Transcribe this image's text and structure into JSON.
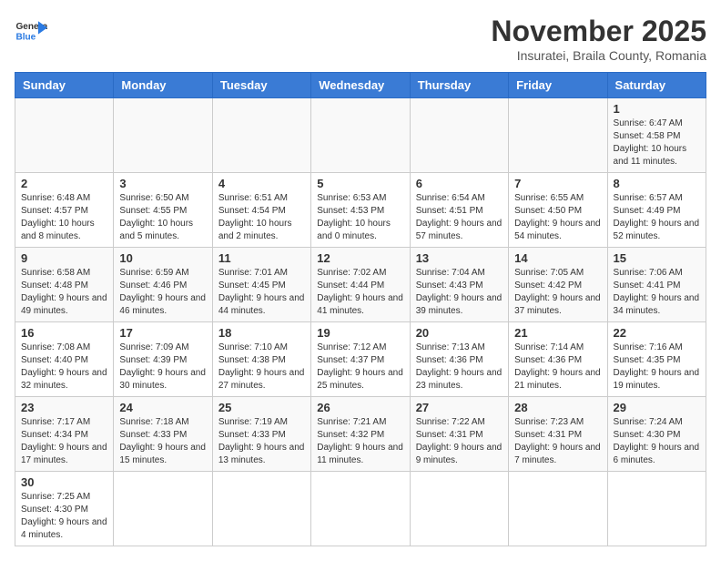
{
  "logo": {
    "text_general": "General",
    "text_blue": "Blue"
  },
  "title": "November 2025",
  "subtitle": "Insuratei, Braila County, Romania",
  "days_of_week": [
    "Sunday",
    "Monday",
    "Tuesday",
    "Wednesday",
    "Thursday",
    "Friday",
    "Saturday"
  ],
  "weeks": [
    [
      null,
      null,
      null,
      null,
      null,
      null,
      {
        "day": "1",
        "info": "Sunrise: 6:47 AM\nSunset: 4:58 PM\nDaylight: 10 hours and 11 minutes."
      }
    ],
    [
      {
        "day": "2",
        "info": "Sunrise: 6:48 AM\nSunset: 4:57 PM\nDaylight: 10 hours and 8 minutes."
      },
      {
        "day": "3",
        "info": "Sunrise: 6:50 AM\nSunset: 4:55 PM\nDaylight: 10 hours and 5 minutes."
      },
      {
        "day": "4",
        "info": "Sunrise: 6:51 AM\nSunset: 4:54 PM\nDaylight: 10 hours and 2 minutes."
      },
      {
        "day": "5",
        "info": "Sunrise: 6:53 AM\nSunset: 4:53 PM\nDaylight: 10 hours and 0 minutes."
      },
      {
        "day": "6",
        "info": "Sunrise: 6:54 AM\nSunset: 4:51 PM\nDaylight: 9 hours and 57 minutes."
      },
      {
        "day": "7",
        "info": "Sunrise: 6:55 AM\nSunset: 4:50 PM\nDaylight: 9 hours and 54 minutes."
      },
      {
        "day": "8",
        "info": "Sunrise: 6:57 AM\nSunset: 4:49 PM\nDaylight: 9 hours and 52 minutes."
      }
    ],
    [
      {
        "day": "9",
        "info": "Sunrise: 6:58 AM\nSunset: 4:48 PM\nDaylight: 9 hours and 49 minutes."
      },
      {
        "day": "10",
        "info": "Sunrise: 6:59 AM\nSunset: 4:46 PM\nDaylight: 9 hours and 46 minutes."
      },
      {
        "day": "11",
        "info": "Sunrise: 7:01 AM\nSunset: 4:45 PM\nDaylight: 9 hours and 44 minutes."
      },
      {
        "day": "12",
        "info": "Sunrise: 7:02 AM\nSunset: 4:44 PM\nDaylight: 9 hours and 41 minutes."
      },
      {
        "day": "13",
        "info": "Sunrise: 7:04 AM\nSunset: 4:43 PM\nDaylight: 9 hours and 39 minutes."
      },
      {
        "day": "14",
        "info": "Sunrise: 7:05 AM\nSunset: 4:42 PM\nDaylight: 9 hours and 37 minutes."
      },
      {
        "day": "15",
        "info": "Sunrise: 7:06 AM\nSunset: 4:41 PM\nDaylight: 9 hours and 34 minutes."
      }
    ],
    [
      {
        "day": "16",
        "info": "Sunrise: 7:08 AM\nSunset: 4:40 PM\nDaylight: 9 hours and 32 minutes."
      },
      {
        "day": "17",
        "info": "Sunrise: 7:09 AM\nSunset: 4:39 PM\nDaylight: 9 hours and 30 minutes."
      },
      {
        "day": "18",
        "info": "Sunrise: 7:10 AM\nSunset: 4:38 PM\nDaylight: 9 hours and 27 minutes."
      },
      {
        "day": "19",
        "info": "Sunrise: 7:12 AM\nSunset: 4:37 PM\nDaylight: 9 hours and 25 minutes."
      },
      {
        "day": "20",
        "info": "Sunrise: 7:13 AM\nSunset: 4:36 PM\nDaylight: 9 hours and 23 minutes."
      },
      {
        "day": "21",
        "info": "Sunrise: 7:14 AM\nSunset: 4:36 PM\nDaylight: 9 hours and 21 minutes."
      },
      {
        "day": "22",
        "info": "Sunrise: 7:16 AM\nSunset: 4:35 PM\nDaylight: 9 hours and 19 minutes."
      }
    ],
    [
      {
        "day": "23",
        "info": "Sunrise: 7:17 AM\nSunset: 4:34 PM\nDaylight: 9 hours and 17 minutes."
      },
      {
        "day": "24",
        "info": "Sunrise: 7:18 AM\nSunset: 4:33 PM\nDaylight: 9 hours and 15 minutes."
      },
      {
        "day": "25",
        "info": "Sunrise: 7:19 AM\nSunset: 4:33 PM\nDaylight: 9 hours and 13 minutes."
      },
      {
        "day": "26",
        "info": "Sunrise: 7:21 AM\nSunset: 4:32 PM\nDaylight: 9 hours and 11 minutes."
      },
      {
        "day": "27",
        "info": "Sunrise: 7:22 AM\nSunset: 4:31 PM\nDaylight: 9 hours and 9 minutes."
      },
      {
        "day": "28",
        "info": "Sunrise: 7:23 AM\nSunset: 4:31 PM\nDaylight: 9 hours and 7 minutes."
      },
      {
        "day": "29",
        "info": "Sunrise: 7:24 AM\nSunset: 4:30 PM\nDaylight: 9 hours and 6 minutes."
      }
    ],
    [
      {
        "day": "30",
        "info": "Sunrise: 7:25 AM\nSunset: 4:30 PM\nDaylight: 9 hours and 4 minutes."
      },
      null,
      null,
      null,
      null,
      null,
      null
    ]
  ],
  "row_colors": [
    "white",
    "shade",
    "white",
    "shade",
    "white",
    "shade"
  ]
}
